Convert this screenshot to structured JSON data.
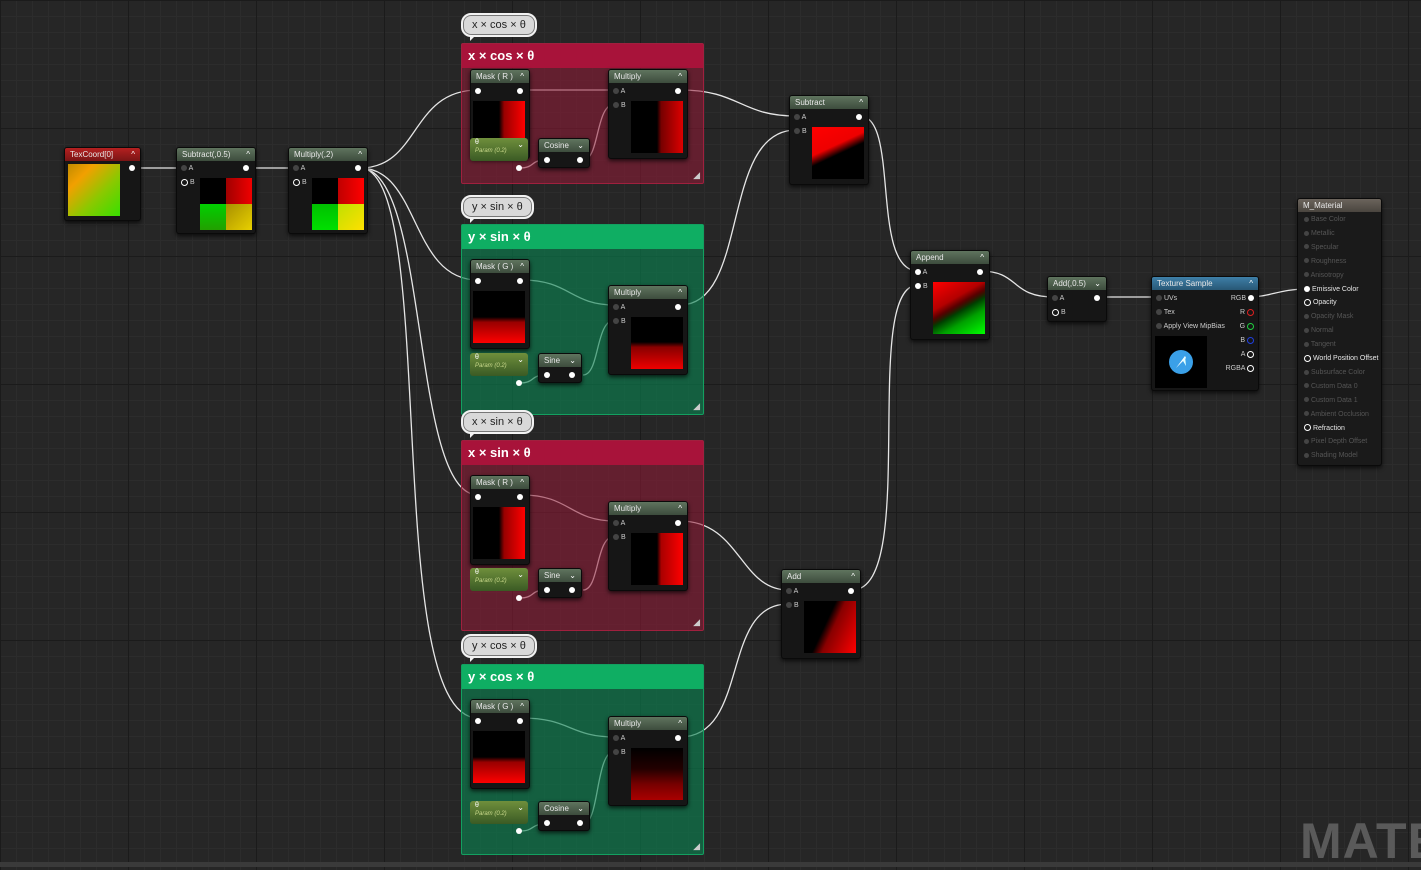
{
  "groups": [
    {
      "id": "g1",
      "title": "x × cos × θ",
      "color": "red",
      "bubble": "x × cos × θ"
    },
    {
      "id": "g2",
      "title": "y × sin × θ",
      "color": "green",
      "bubble": "y × sin × θ"
    },
    {
      "id": "g3",
      "title": "x × sin × θ",
      "color": "red",
      "bubble": "x × sin × θ"
    },
    {
      "id": "g4",
      "title": "y × cos × θ",
      "color": "green",
      "bubble": "y × cos × θ"
    }
  ],
  "nodes": {
    "texcoord": {
      "title": "TexCoord[0]"
    },
    "subtract05": {
      "title": "Subtract(,0.5)",
      "pin_a": "A",
      "pin_b": "B"
    },
    "multiply2": {
      "title": "Multiply(,2)",
      "pin_a": "A",
      "pin_b": "B"
    },
    "mask_r": "Mask ( R )",
    "mask_g": "Mask ( G )",
    "multiply": "Multiply",
    "cosine": "Cosine",
    "sine": "Sine",
    "param_theta": "θ",
    "param_sub": "Param (0.2)",
    "subtract": {
      "title": "Subtract",
      "pin_a": "A",
      "pin_b": "B"
    },
    "add": {
      "title": "Add",
      "pin_a": "A",
      "pin_b": "B"
    },
    "append": {
      "title": "Append",
      "pin_a": "A",
      "pin_b": "B"
    },
    "add05": {
      "title": "Add(,0.5)",
      "pin_a": "A",
      "pin_b": "B"
    },
    "pin_a": "A",
    "pin_b": "B",
    "texture_sample": {
      "title": "Texture Sample",
      "inputs": [
        "UVs",
        "Tex",
        "Apply View MipBias"
      ],
      "outputs": [
        "RGB",
        "R",
        "G",
        "B",
        "A",
        "RGBA"
      ]
    },
    "material": {
      "title": "M_Material",
      "pins": [
        {
          "label": "Base Color",
          "active": false
        },
        {
          "label": "Metallic",
          "active": false
        },
        {
          "label": "Specular",
          "active": false
        },
        {
          "label": "Roughness",
          "active": false
        },
        {
          "label": "Anisotropy",
          "active": false
        },
        {
          "label": "Emissive Color",
          "active": true
        },
        {
          "label": "Opacity",
          "active": true
        },
        {
          "label": "Opacity Mask",
          "active": false
        },
        {
          "label": "Normal",
          "active": false
        },
        {
          "label": "Tangent",
          "active": false
        },
        {
          "label": "World Position Offset",
          "active": true
        },
        {
          "label": "Subsurface Color",
          "active": false
        },
        {
          "label": "Custom Data 0",
          "active": false
        },
        {
          "label": "Custom Data 1",
          "active": false
        },
        {
          "label": "Ambient Occlusion",
          "active": false
        },
        {
          "label": "Refraction",
          "active": true
        },
        {
          "label": "Pixel Depth Offset",
          "active": false
        },
        {
          "label": "Shading Model",
          "active": false
        }
      ]
    }
  },
  "watermark": "MATE",
  "colors": {
    "red_group": "#a8133a",
    "green_group": "#0fae63",
    "grid": "#262626"
  }
}
